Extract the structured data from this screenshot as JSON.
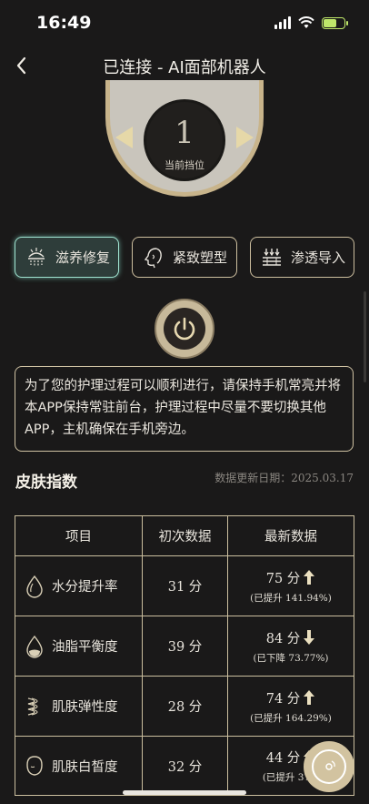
{
  "status": {
    "time": "16:49"
  },
  "header": {
    "title": "已连接 - AI面部机器人"
  },
  "dial": {
    "value": "1",
    "label": "当前挡位"
  },
  "modes": [
    {
      "label": "滋养修复",
      "active": true
    },
    {
      "label": "紧致塑型",
      "active": false
    },
    {
      "label": "渗透导入",
      "active": false
    }
  ],
  "notice": "为了您的护理过程可以顺利进行，请保持手机常亮并将本APP保持常驻前台，护理过程中尽量不要切换其他APP，主机确保在手机旁边。",
  "skin": {
    "title": "皮肤指数",
    "date_label": "数据更新日期：",
    "date_value": "2025.03.17",
    "columns": [
      "项目",
      "初次数据",
      "最新数据"
    ],
    "rows": [
      {
        "name": "水分提升率",
        "first": "31 分",
        "latest": "75 分",
        "trend": "up",
        "change": "(已提升 141.94%)"
      },
      {
        "name": "油脂平衡度",
        "first": "39 分",
        "latest": "84 分",
        "trend": "down",
        "change": "(已下降 73.77%)"
      },
      {
        "name": "肌肤弹性度",
        "first": "28 分",
        "latest": "74 分",
        "trend": "up",
        "change": "(已提升 164.29%)"
      },
      {
        "name": "肌肤白皙度",
        "first": "32 分",
        "latest": "44 分",
        "trend": "up",
        "change": "(已提升 37.5"
      }
    ]
  },
  "colors": {
    "gold": "#cbbf9f",
    "active_mode": "#9fe3d0",
    "background": "#1a1919"
  }
}
